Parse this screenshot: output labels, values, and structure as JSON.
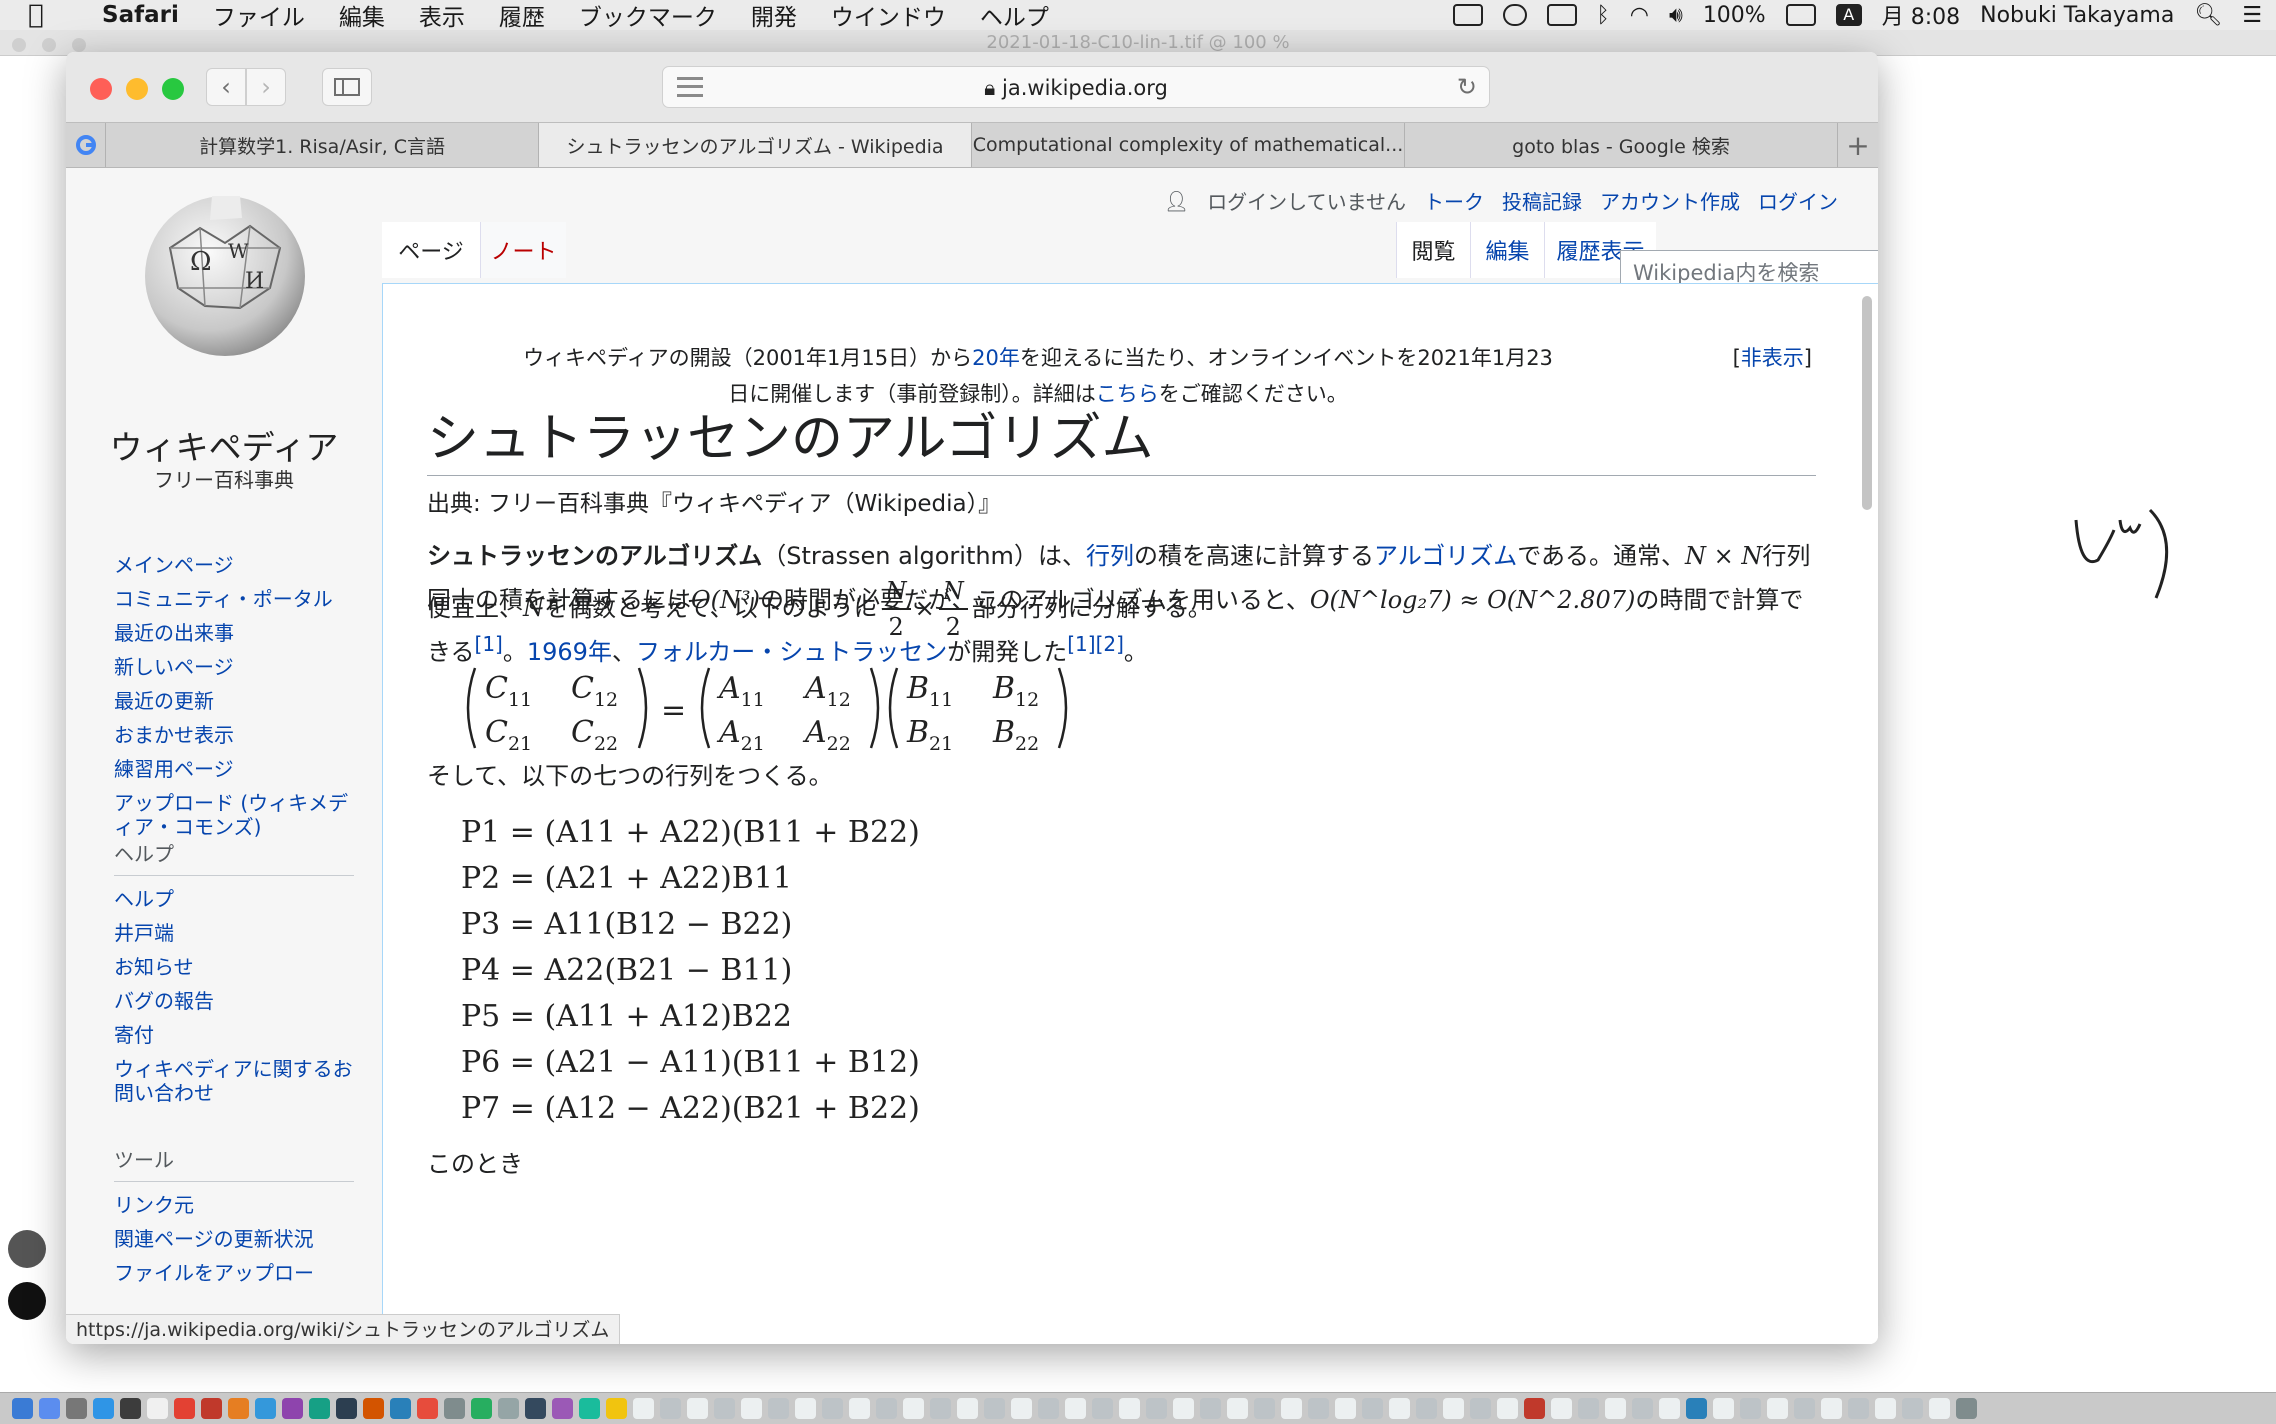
{
  "menubar": {
    "app_name": "Safari",
    "menus": [
      "ファイル",
      "編集",
      "表示",
      "履歴",
      "ブックマーク",
      "開発",
      "ウインドウ",
      "ヘルプ"
    ],
    "battery": "100%",
    "input_mode": "A",
    "clock": "月 8:08",
    "user": "Nobuki Takayama"
  },
  "background_window": {
    "title": "2021-01-18-C10-lin-1.tif @ 100 %"
  },
  "safari": {
    "address": "ja.wikipedia.org",
    "tabs": [
      {
        "label": "計算数学1. Risa/Asir, C言語"
      },
      {
        "label": "シュトラッセンのアルゴリズム - Wikipedia"
      },
      {
        "label": "Computational complexity of mathematical..."
      },
      {
        "label": "goto blas - Google 検索"
      }
    ],
    "status_url": "https://ja.wikipedia.org/wiki/シュトラッセンのアルゴリズム"
  },
  "wiki": {
    "logo_name": "ウィキペディア",
    "logo_tagline": "フリー百科事典",
    "personal": {
      "not_logged_in": "ログインしていません",
      "talk": "トーク",
      "contributions": "投稿記録",
      "create_account": "アカウント作成",
      "login": "ログイン"
    },
    "tabs": {
      "page": "ページ",
      "note": "ノート",
      "read": "閲覧",
      "edit": "編集",
      "history": "履歴表示"
    },
    "search_placeholder": "Wikipedia内を検索",
    "nav_main": [
      {
        "label": "メインページ"
      },
      {
        "label": "コミュニティ・ポータル"
      },
      {
        "label": "最近の出来事"
      },
      {
        "label": "新しいページ"
      },
      {
        "label": "最近の更新"
      },
      {
        "label": "おまかせ表示"
      },
      {
        "label": "練習用ページ"
      },
      {
        "label": "アップロード (ウィキメディア・コモンズ)"
      }
    ],
    "nav_help_heading": "ヘルプ",
    "nav_help": [
      {
        "label": "ヘルプ"
      },
      {
        "label": "井戸端"
      },
      {
        "label": "お知らせ"
      },
      {
        "label": "バグの報告"
      },
      {
        "label": "寄付"
      },
      {
        "label": "ウィキペディアに関するお問い合わせ"
      }
    ],
    "nav_tools_heading": "ツール",
    "nav_tools": [
      {
        "label": "リンク元"
      },
      {
        "label": "関連ページの更新状況"
      },
      {
        "label": "ファイルをアップロー"
      }
    ],
    "notice": {
      "part1": "ウィキペディアの開設（2001年1月15日）から",
      "link1": "20年",
      "part2": "を迎えるに当たり、オンラインイベントを2021年1月23日に開催します（事前登録制）。詳細は",
      "link2": "こちら",
      "part3": "をご確認ください。",
      "hide": "非表示"
    },
    "title": "シュトラッセンのアルゴリズム",
    "from": "出典: フリー百科事典『ウィキペディア（Wikipedia）』",
    "intro": {
      "bold": "シュトラッセンのアルゴリズム",
      "t1": "（Strassen algorithm）は、",
      "link_matrix": "行列",
      "t2": "の積を高速に計算する",
      "link_algo": "アルゴリズム",
      "t3": "である。通常、",
      "nxn": "N × N",
      "t4": "行列同士の積を計算するには",
      "on3": "O(N³)",
      "t5": "の時間が必要だが、このアルゴリズムを用いると、",
      "olog": "O(N^log₂7) ≈ O(N^2.807)",
      "t6": "の時間で計算できる",
      "ref1": "[1]",
      "t7": "。",
      "link_year": "1969年",
      "t8": "、",
      "link_person": "フォルカー・シュトラッセン",
      "t9": "が開発した",
      "ref2": "[1][2]",
      "t10": "。"
    },
    "decompose": {
      "t1": "便宜上、",
      "n": "N",
      "t2": "を偶数と考えて、以下のように",
      "num": "N",
      "den": "2",
      "times": "×",
      "t3": "部分行列に分解する。"
    },
    "seven": "そして、以下の七つの行列をつくる。",
    "equations": [
      "P1 = (A11 + A22)(B11 + B22)",
      "P2 = (A21 + A22)B11",
      "P3 = A11(B12 − B22)",
      "P4 = A22(B21 − B11)",
      "P5 = (A11 + A12)B22",
      "P6 = (A21 − A11)(B11 + B12)",
      "P7 = (A12 − A22)(B21 + B22)"
    ],
    "next_line": "このとき"
  }
}
